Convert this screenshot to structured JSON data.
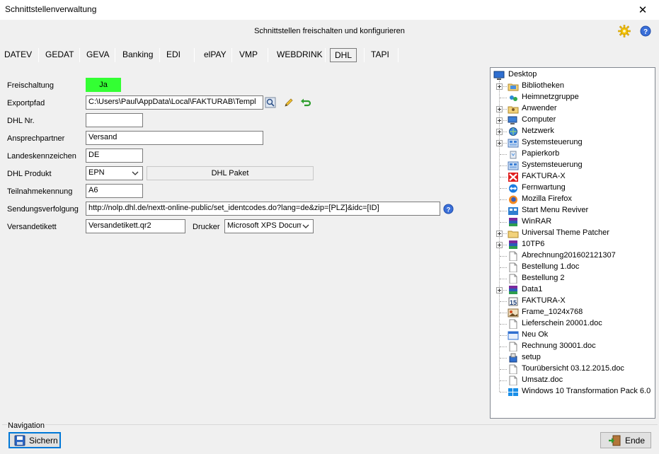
{
  "window": {
    "title": "Schnittstellenverwaltung",
    "close": "✕"
  },
  "header": {
    "text": "Schnittstellen freischalten und konfigurieren"
  },
  "tabs": [
    "DATEV",
    "GEDAT",
    "GEVA",
    "Banking",
    "EDI",
    "elPAY",
    "VMP",
    "WEBDRINK",
    "DHL",
    "TAPI"
  ],
  "active_tab": "DHL",
  "form": {
    "freischaltung": {
      "label": "Freischaltung",
      "value": "Ja"
    },
    "exportpfad": {
      "label": "Exportpfad",
      "value": "C:\\Users\\Paul\\AppData\\Local\\FAKTURAB\\Templ"
    },
    "dhl_nr": {
      "label": "DHL Nr.",
      "value": ""
    },
    "ansprechpartner": {
      "label": "Ansprechpartner",
      "value": "Versand"
    },
    "landeskennzeichen": {
      "label": "Landeskennzeichen",
      "value": "DE"
    },
    "dhl_produkt": {
      "label": "DHL Produkt",
      "value": "EPN",
      "description": "DHL Paket"
    },
    "teilnahmekennung": {
      "label": "Teilnahmekennung",
      "value": "A6"
    },
    "sendungsverfolgung": {
      "label": "Sendungsverfolgung",
      "value": "http://nolp.dhl.de/nextt-online-public/set_identcodes.do?lang=de&zip=[PLZ]&idc=[ID]"
    },
    "versandetikett": {
      "label": "Versandetikett",
      "value": "Versandetikett.qr2"
    },
    "drucker": {
      "label": "Drucker",
      "value": "Microsoft XPS Docum"
    }
  },
  "tree": {
    "root": "Desktop",
    "items": [
      {
        "label": "Bibliotheken",
        "icon": "library-icon",
        "expandable": true
      },
      {
        "label": "Heimnetzgruppe",
        "icon": "homegroup-icon",
        "expandable": false
      },
      {
        "label": "Anwender",
        "icon": "user-folder-icon",
        "expandable": true
      },
      {
        "label": "Computer",
        "icon": "computer-icon",
        "expandable": true
      },
      {
        "label": "Netzwerk",
        "icon": "network-icon",
        "expandable": true
      },
      {
        "label": "Systemsteuerung",
        "icon": "control-panel-icon",
        "expandable": true
      },
      {
        "label": "Papierkorb",
        "icon": "recycle-bin-icon",
        "expandable": false
      },
      {
        "label": "Systemsteuerung",
        "icon": "control-panel-icon",
        "expandable": false
      },
      {
        "label": "FAKTURA-X",
        "icon": "faktura-icon",
        "expandable": false
      },
      {
        "label": "Fernwartung",
        "icon": "teamviewer-icon",
        "expandable": false
      },
      {
        "label": "Mozilla Firefox",
        "icon": "firefox-icon",
        "expandable": false
      },
      {
        "label": "Start Menu Reviver",
        "icon": "app-icon",
        "expandable": false
      },
      {
        "label": "WinRAR",
        "icon": "winrar-icon",
        "expandable": false
      },
      {
        "label": "Universal Theme Patcher",
        "icon": "folder-icon",
        "expandable": true
      },
      {
        "label": "10TP6",
        "icon": "archive-icon",
        "expandable": true
      },
      {
        "label": "Abrechnung201602121307",
        "icon": "document-icon",
        "expandable": false
      },
      {
        "label": "Bestellung 1.doc",
        "icon": "document-icon",
        "expandable": false
      },
      {
        "label": "Bestellung 2",
        "icon": "document-icon",
        "expandable": false
      },
      {
        "label": "Data1",
        "icon": "archive-icon",
        "expandable": true
      },
      {
        "label": "FAKTURA-X",
        "icon": "calendar-icon",
        "expandable": false
      },
      {
        "label": "Frame_1024x768",
        "icon": "image-icon",
        "expandable": false
      },
      {
        "label": "Lieferschein 20001.doc",
        "icon": "document-icon",
        "expandable": false
      },
      {
        "label": "Neu Ok",
        "icon": "window-icon",
        "expandable": false
      },
      {
        "label": "Rechnung 30001.doc",
        "icon": "document-icon",
        "expandable": false
      },
      {
        "label": "setup",
        "icon": "setup-icon",
        "expandable": false
      },
      {
        "label": "Tourübersicht 03.12.2015.doc",
        "icon": "document-icon",
        "expandable": false
      },
      {
        "label": "Umsatz.doc",
        "icon": "document-icon",
        "expandable": false
      },
      {
        "label": "Windows 10 Transformation Pack 6.0",
        "icon": "windows-icon",
        "expandable": false
      }
    ]
  },
  "navigation": {
    "label": "Navigation",
    "save": "Sichern",
    "end": "Ende"
  },
  "colors": {
    "active_green": "#33ff33",
    "focus_blue": "#0078d7"
  }
}
